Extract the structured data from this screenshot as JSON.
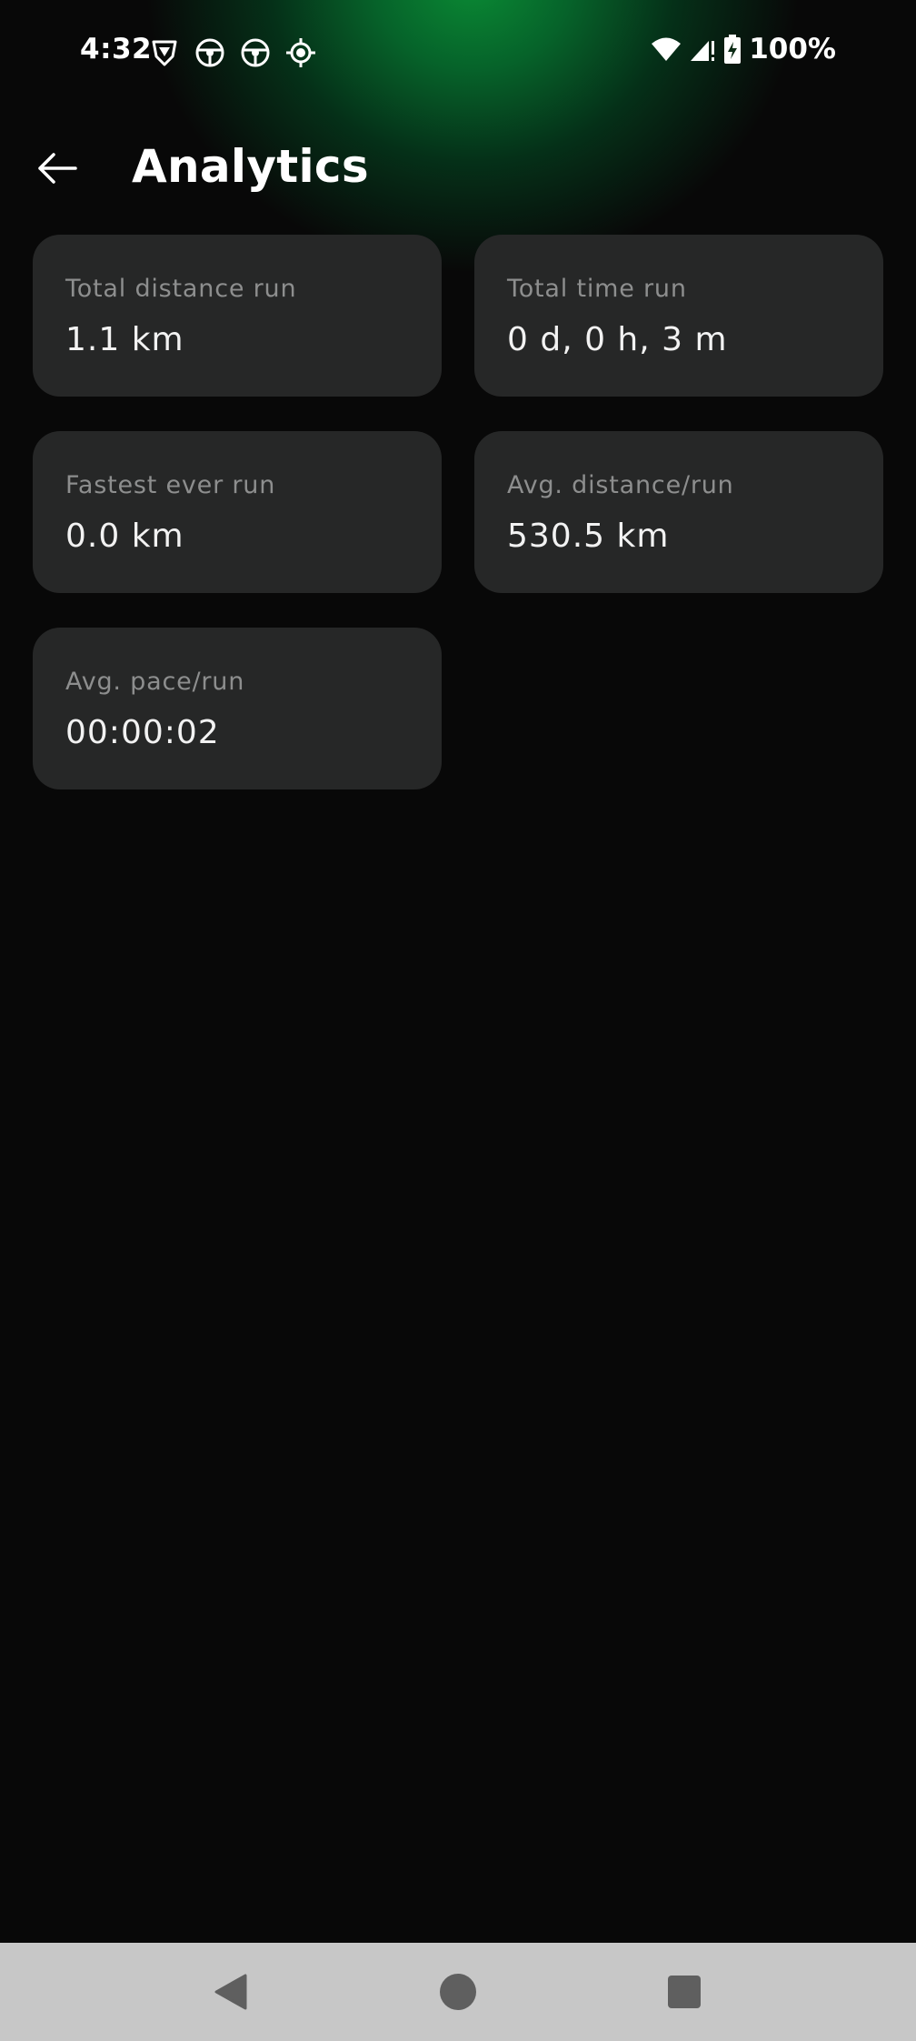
{
  "status_bar": {
    "time": "4:32",
    "left_icons": [
      "brave-browser-icon",
      "steering-wheel-icon",
      "steering-wheel-icon",
      "location-target-icon"
    ],
    "right_icons": [
      "wifi-icon",
      "signal-alert-icon",
      "battery-charging-icon"
    ],
    "battery_percent": "100%"
  },
  "header": {
    "back_icon": "arrow-left-icon",
    "title": "Analytics"
  },
  "cards": [
    {
      "label": "Total distance run",
      "value": "1.1 km"
    },
    {
      "label": "Total time run",
      "value": "0 d, 0 h, 3 m"
    },
    {
      "label": "Fastest ever run",
      "value": "0.0 km"
    },
    {
      "label": "Avg. distance/run",
      "value": "530.5 km"
    },
    {
      "label": "Avg. pace/run",
      "value": "00:00:02"
    }
  ],
  "nav_bar": {
    "buttons": [
      "back-triangle-icon",
      "home-circle-icon",
      "recents-square-icon"
    ]
  },
  "colors": {
    "accent_glow": "#0a8a34",
    "background": "#080808",
    "card": "#262727",
    "label_text": "#8d8e8e",
    "value_text": "#f2f2f2",
    "nav_bar": "#c7c7c7"
  }
}
